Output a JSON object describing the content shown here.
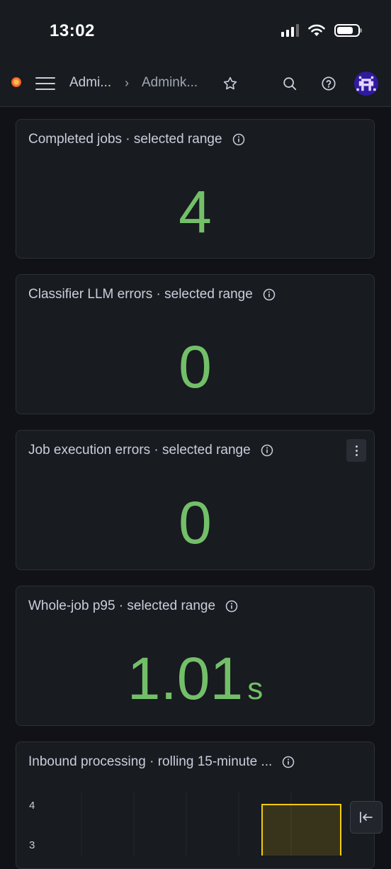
{
  "status_bar": {
    "time": "13:02"
  },
  "topnav": {
    "breadcrumb": [
      "Admi...",
      "Admink..."
    ],
    "breadcrumb_separator": "›",
    "icons": [
      "menu-icon",
      "star-icon",
      "search-icon",
      "help-icon",
      "avatar"
    ]
  },
  "panels": [
    {
      "title": "Completed jobs · selected range",
      "value": "4"
    },
    {
      "title": "Classifier LLM errors · selected range",
      "value": "0"
    },
    {
      "title": "Job execution errors · selected range",
      "value": "0"
    },
    {
      "title": "Whole-job p95 · selected range",
      "value": "1.01",
      "unit": "s"
    },
    {
      "title": "Inbound processing · rolling 15-minute ..."
    }
  ],
  "chart_data": {
    "type": "bar",
    "y_ticks": [
      "4",
      "3"
    ],
    "values": [
      4
    ],
    "bar_color": "#f2cc0c"
  },
  "colors": {
    "stat_green": "#73bf69",
    "panel_bg": "#181b1f",
    "page_bg": "#111217"
  }
}
